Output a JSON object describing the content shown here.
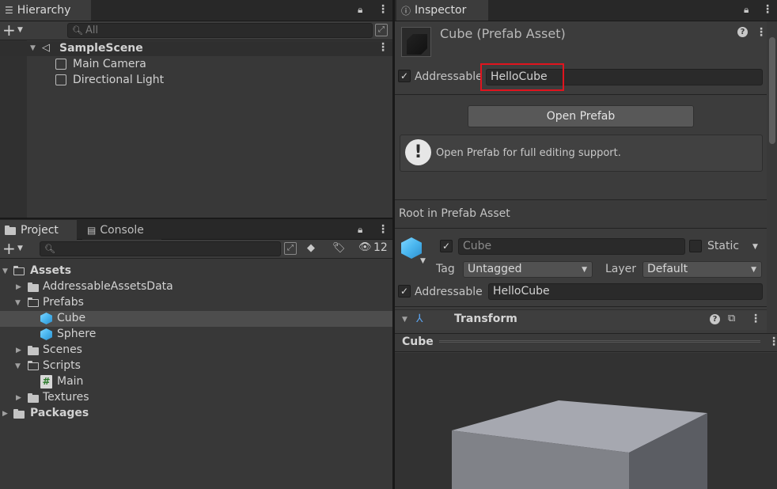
{
  "hierarchy": {
    "tab_label": "Hierarchy",
    "search_placeholder": "All",
    "scene_name": "SampleScene",
    "items": [
      {
        "label": "Main Camera"
      },
      {
        "label": "Directional Light"
      }
    ]
  },
  "project": {
    "tab_label": "Project",
    "console_tab_label": "Console",
    "hidden_count": "12",
    "tree": {
      "assets": "Assets",
      "addressable_assets_data": "AddressableAssetsData",
      "prefabs": "Prefabs",
      "cube": "Cube",
      "sphere": "Sphere",
      "scenes": "Scenes",
      "scripts": "Scripts",
      "main": "Main",
      "textures": "Textures",
      "packages": "Packages"
    }
  },
  "inspector": {
    "tab_label": "Inspector",
    "asset_title": "Cube (Prefab Asset)",
    "addressable_label": "Addressable",
    "addressable_address": "HelloCube",
    "addressable_checked": true,
    "open_prefab_label": "Open Prefab",
    "info_message": "Open Prefab for full editing support.",
    "root_header": "Root in Prefab Asset",
    "object_name": "Cube",
    "static_label": "Static",
    "tag_label": "Tag",
    "tag_value": "Untagged",
    "layer_label": "Layer",
    "layer_value": "Default",
    "addressable2_label": "Addressable",
    "addressable2_address": "HelloCube",
    "component_name": "Transform",
    "preview_title": "Cube",
    "highlight_color": "#e0141e"
  }
}
